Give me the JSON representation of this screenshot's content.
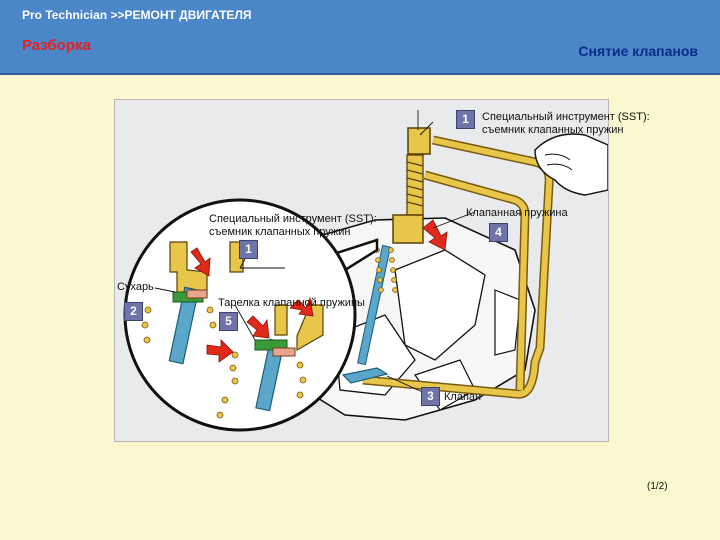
{
  "header": {
    "breadcrumb": "Pro Technician >>РЕМОНТ ДВИГАТЕЛЯ",
    "section": "Разборка",
    "subtitle": "Снятие клапанов"
  },
  "figure": {
    "labels": {
      "sst_main": "Специальный инструмент (SST):\nсъемник клапанных пружин",
      "sst_inset": "Специальный инструмент (SST):\nсъемник клапанных пружин",
      "spring": "Клапанная пружина",
      "keepers": "Сухарь",
      "retainer": "Тарелка клапанной пружины",
      "valve": "Клапан"
    },
    "badges": [
      "1",
      "4",
      "3",
      "1",
      "2",
      "5"
    ]
  },
  "footer": {
    "page": "(1/2)"
  },
  "colors": {
    "header_bg": "#4a86c8",
    "section": "#e82020",
    "subtitle": "#0a2a8a",
    "tool": "#e8c64a",
    "valve": "#5aa7c9",
    "arrow": "#e02a1a"
  }
}
